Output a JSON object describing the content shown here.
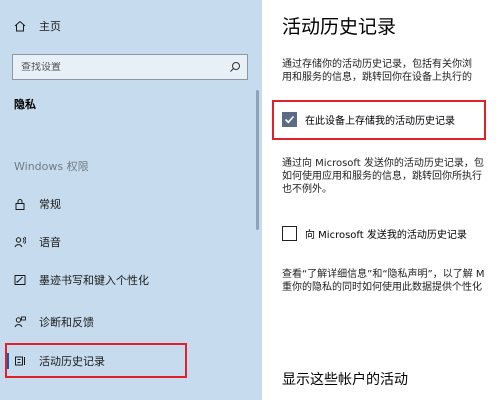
{
  "sidebar": {
    "home_label": "主页",
    "search_placeholder": "查找设置",
    "section_title": "隐私",
    "group_label": "Windows 权限",
    "items": [
      {
        "label": "常规",
        "icon": "lock-icon"
      },
      {
        "label": "语音",
        "icon": "voice-icon"
      },
      {
        "label": "墨迹书写和键入个性化",
        "icon": "pen-icon"
      },
      {
        "label": "诊断和反馈",
        "icon": "feedback-icon"
      },
      {
        "label": "活动历史记录",
        "icon": "timeline-icon",
        "active": true
      }
    ]
  },
  "main": {
    "title": "活动历史记录",
    "para1": [
      "通过存储你的活动历史记录，包括有关你浏",
      "用和服务的信息，跳转回你在设备上执行的"
    ],
    "checkbox1": {
      "label": "在此设备上存储我的活动历史记录",
      "checked": true
    },
    "para2": [
      "通过向 Microsoft 发送你的活动历史记录，包",
      "如何使用应用和服务的信息，跳转回你所执行",
      "也不例外。"
    ],
    "checkbox2": {
      "label": "向 Microsoft 发送我的活动历史记录",
      "checked": false
    },
    "para3": [
      "查看“了解详细信息”和“隐私声明”，以了解 M",
      "重你的隐私的同时如何使用此数据提供个性化"
    ],
    "subheading": "显示这些帐户的活动"
  },
  "colors": {
    "sidebar_bg": "#c6dcee",
    "highlight_red": "#e0202a",
    "checkbox_checked": "#5b6a86"
  }
}
